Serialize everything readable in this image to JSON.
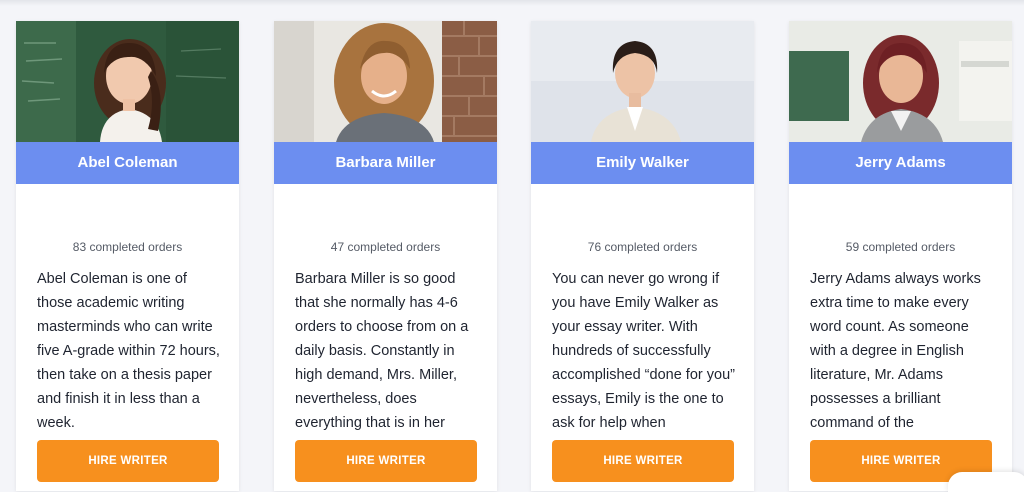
{
  "colors": {
    "name_bar": "#6c8ef0",
    "hire_button": "#f7901e",
    "page_background": "#f4f5f9"
  },
  "writers": [
    {
      "name": "Abel Coleman",
      "orders": "83 completed orders",
      "bio": "Abel Coleman is one of those academic writing masterminds who can write five A-grade within 72 hours, then take on a thesis paper and finish it in less than a week.",
      "button": "HIRE WRITER"
    },
    {
      "name": "Barbara Miller",
      "orders": "47 completed orders",
      "bio": "Barbara Miller is so good that she normally has 4-6 orders to choose from on a daily basis. Constantly in high demand, Mrs. Miller, nevertheless, does everything that is in her",
      "button": "HIRE WRITER"
    },
    {
      "name": "Emily Walker",
      "orders": "76 completed orders",
      "bio": "You can never go wrong if you have Emily Walker as your essay writer. With hundreds of successfully accomplished “done for you” essays, Emily is the one to ask for help when",
      "button": "HIRE WRITER"
    },
    {
      "name": "Jerry Adams",
      "orders": "59 completed orders",
      "bio": "Jerry Adams always works extra time to make every word count. As someone with a degree in English literature, Mr. Adams possesses a brilliant command of the",
      "button": "HIRE WRITER"
    }
  ]
}
